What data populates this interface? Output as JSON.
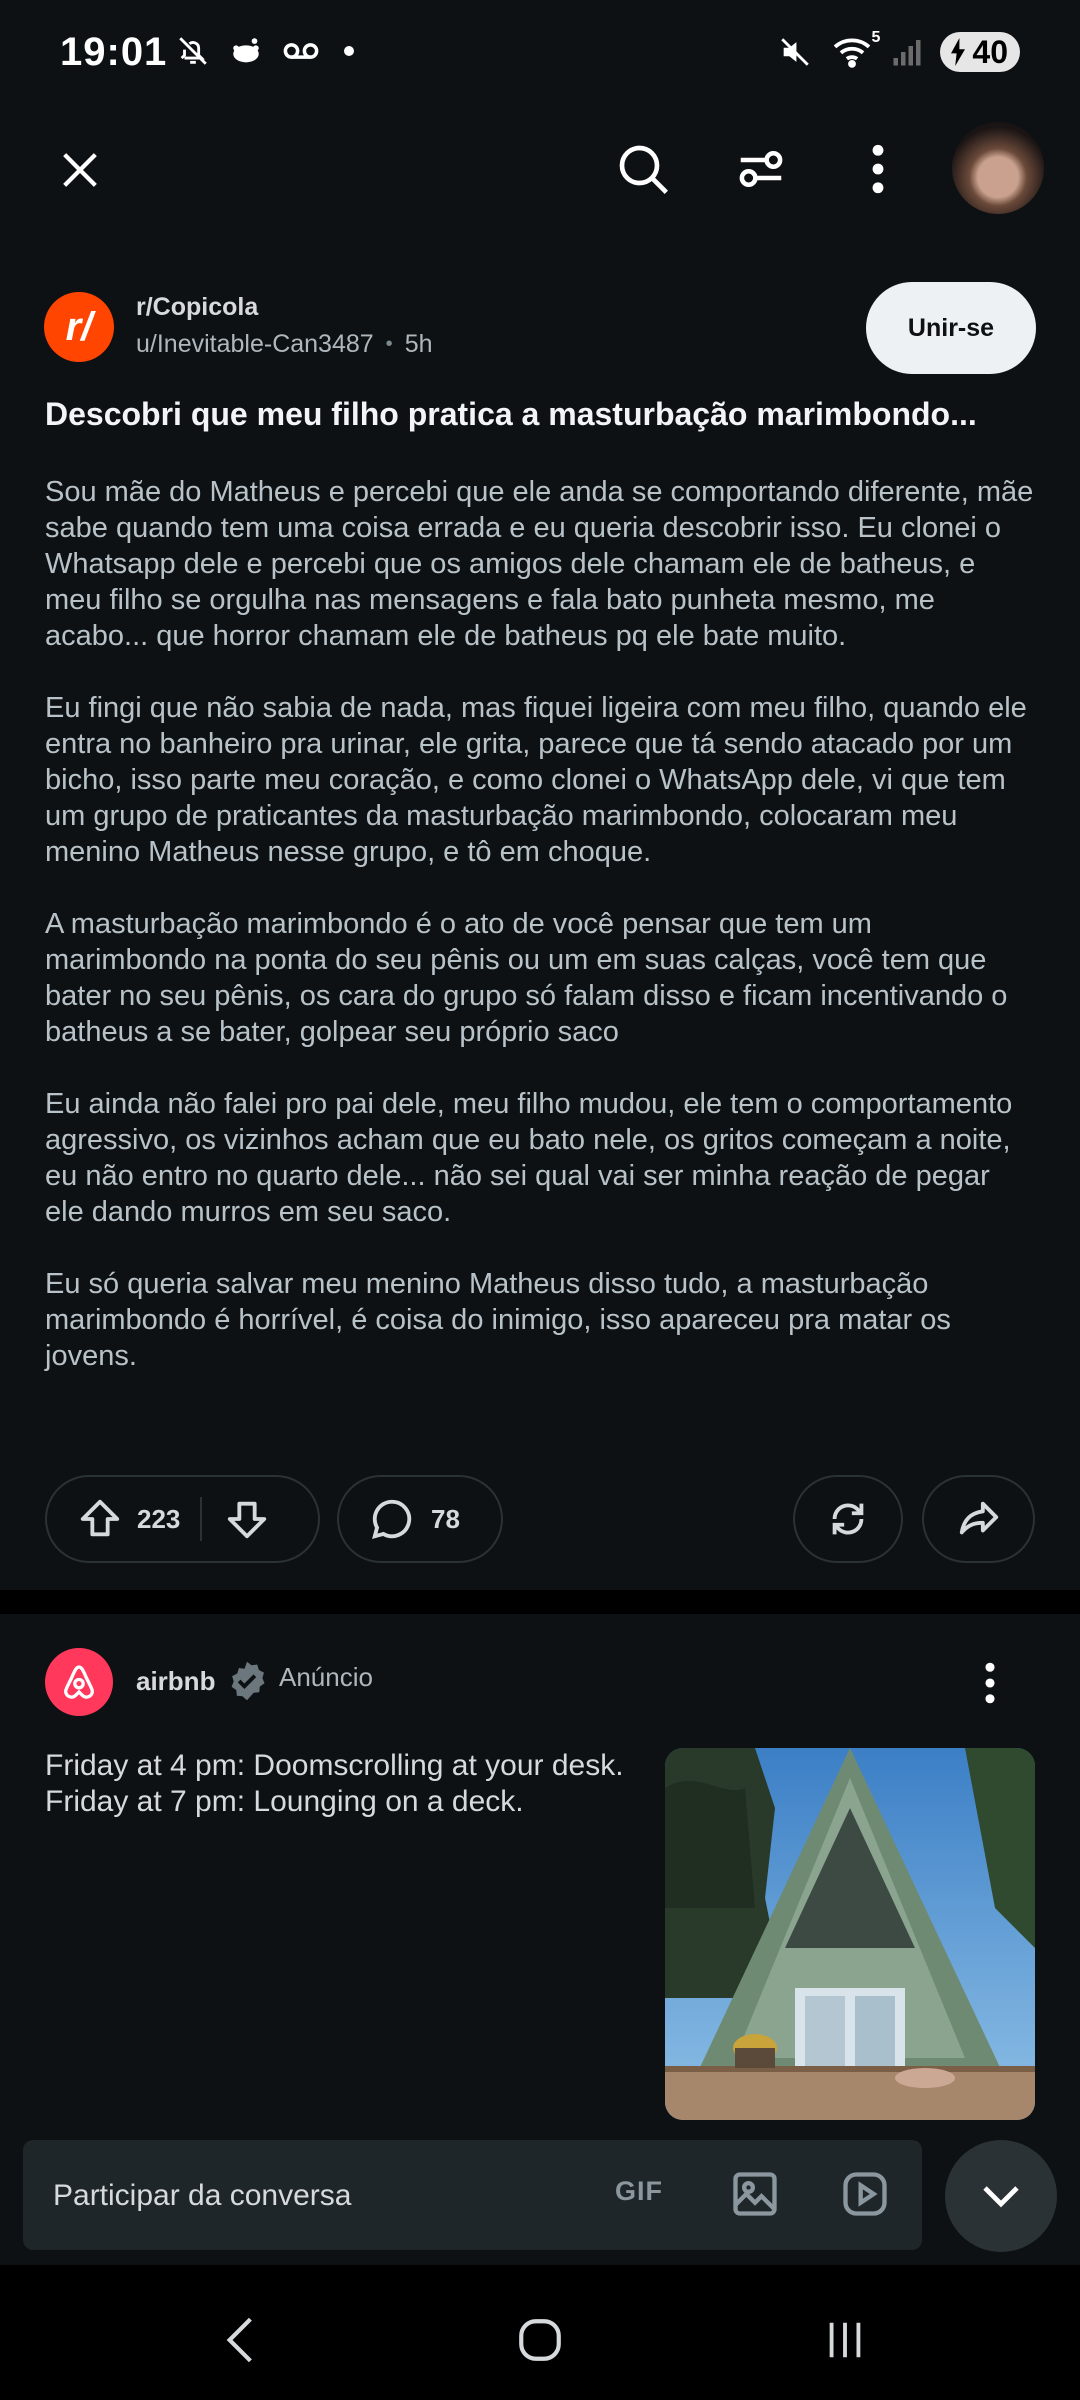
{
  "status_bar": {
    "time": "19:01",
    "battery": "40",
    "wifi_label": "5"
  },
  "topbar": {
    "icons": [
      "close-icon",
      "search-icon",
      "filter-icon",
      "more-vertical-icon"
    ]
  },
  "post": {
    "subreddit": "r/Copicola",
    "subreddit_logo_text": "r/",
    "username": "u/Inevitable-Can3487",
    "separator": "•",
    "time": "5h",
    "join_label": "Unir-se",
    "title": "Descobri que meu filho pratica a masturbação marimbondo...",
    "paragraphs": [
      "Sou mãe do Matheus e percebi que ele anda se comportando diferente, mãe sabe quando tem uma coisa errada e eu queria descobrir isso. Eu clonei o Whatsapp dele e percebi que os amigos dele chamam ele de batheus, e meu filho se orgulha nas mensagens e fala bato punheta mesmo, me acabo... que horror chamam ele de batheus pq ele bate muito.",
      "Eu fingi que não sabia de nada, mas fiquei ligeira com meu filho, quando ele entra no banheiro pra urinar, ele grita, parece que tá sendo atacado por um bicho, isso parte meu coração, e como clonei o WhatsApp dele, vi que tem um grupo de praticantes da masturbação marimbondo, colocaram meu menino Matheus nesse grupo, e tô em choque.",
      "A masturbação marimbondo é o ato de você pensar que tem um marimbondo na ponta do seu pênis ou um em suas calças, você tem que bater no seu pênis, os cara do grupo só falam disso e ficam incentivando o batheus a se bater, golpear seu próprio saco",
      "Eu ainda não falei pro pai dele, meu filho mudou, ele tem o comportamento agressivo, os vizinhos acham que eu bato nele, os gritos começam a noite, eu não entro no quarto dele... não sei qual vai ser minha reação de pegar ele dando murros em seu saco.",
      "Eu só queria salvar meu menino Matheus disso tudo, a masturbação marimbondo é horrível, é coisa do inimigo, isso apareceu pra matar os jovens."
    ],
    "votes": "223",
    "comments": "78"
  },
  "ad": {
    "advertiser": "airbnb",
    "label": "Anúncio",
    "text": "Friday at 4 pm: Doomscrolling at your desk. Friday at 7 pm: Lounging on a deck."
  },
  "composer": {
    "placeholder": "Participar da conversa",
    "gif_label": "GIF"
  },
  "colors": {
    "background": "#0e1113",
    "subreddit_accent": "#ff4500",
    "airbnb_accent": "#ff385c",
    "join_button_bg": "#eef1f3"
  }
}
